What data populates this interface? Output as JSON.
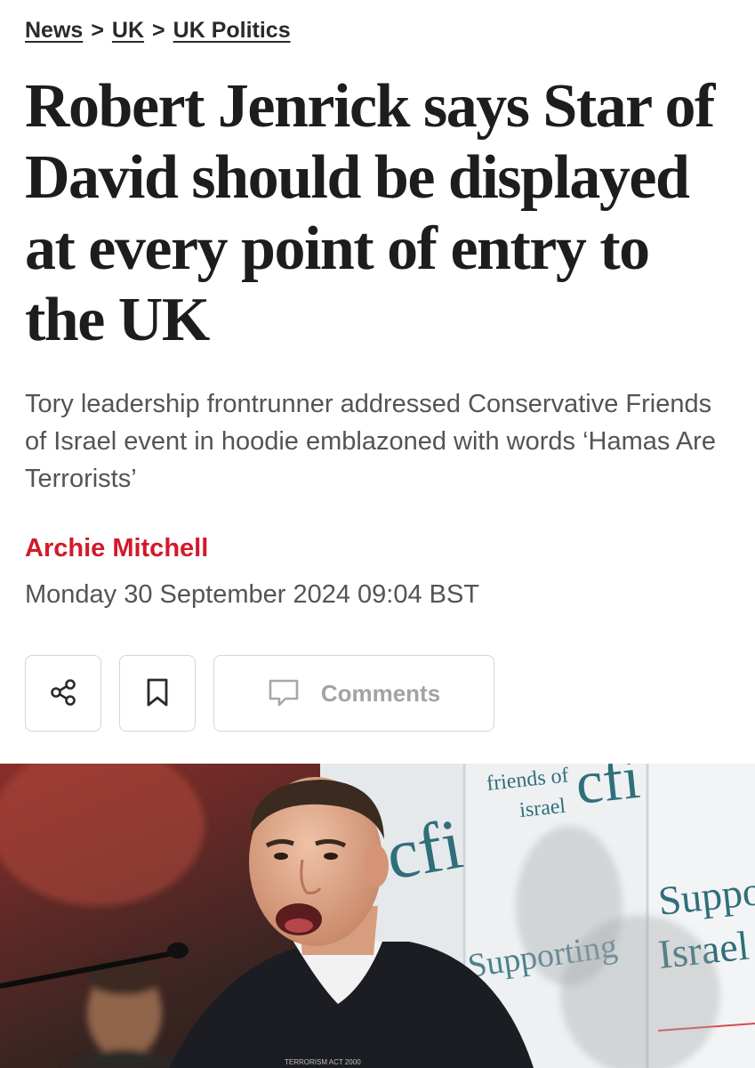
{
  "breadcrumb": {
    "items": [
      "News",
      "UK",
      "UK Politics"
    ],
    "separator": ">"
  },
  "article": {
    "headline": "Robert Jenrick says Star of David should be displayed at every point of entry to the UK",
    "standfirst": "Tory leadership frontrunner addressed Conservative Friends of Israel event in hoodie emblazoned with words ‘Hamas Are Terrorists’",
    "author": "Archie Mitchell",
    "date": "Monday 30 September 2024 09:04 BST"
  },
  "actions": {
    "share_icon": "share-icon",
    "bookmark_icon": "bookmark-icon",
    "comments_icon": "comment-icon",
    "comments_label": "Comments"
  },
  "hero_image": {
    "backdrop_text": {
      "friends": "friends of",
      "israel": "israel",
      "logo": "cfi",
      "supporting": "Supporting",
      "right_panel_1": "Suppo",
      "right_panel_2": "Israel"
    },
    "colors": {
      "backdrop": "#eef0f2",
      "logo": "#2f6f7a",
      "hoodie": "#1c1d22"
    }
  },
  "colors": {
    "author": "#d11a2a",
    "muted": "#545454"
  }
}
